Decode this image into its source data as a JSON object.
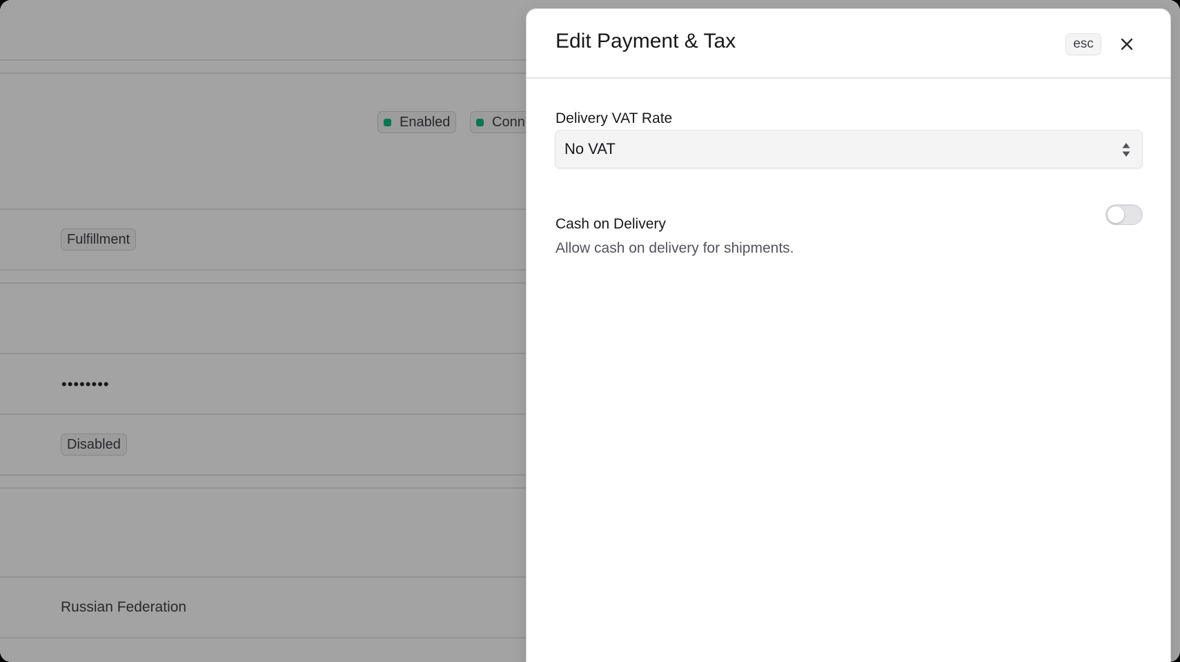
{
  "background": {
    "badges_top": [
      {
        "label": "Enabled"
      },
      {
        "label": "Conn"
      }
    ],
    "fulfillment_badge": "Fulfillment",
    "password_mask": "••••••••",
    "disabled_badge": "Disabled",
    "country": "Russian Federation",
    "status_color": "#10b981"
  },
  "drawer": {
    "title": "Edit Payment & Tax",
    "esc_label": "esc",
    "close_icon": "close-icon",
    "vat": {
      "label": "Delivery VAT Rate",
      "selected": "No VAT"
    },
    "cod": {
      "label": "Cash on Delivery",
      "enabled": false,
      "description": "Allow cash on delivery for shipments."
    }
  }
}
